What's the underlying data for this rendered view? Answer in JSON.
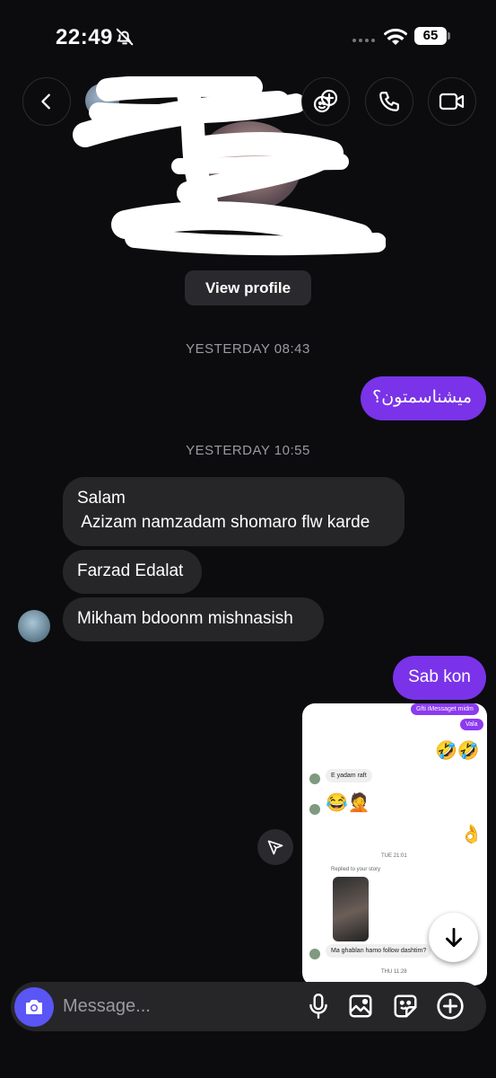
{
  "status_bar": {
    "time": "22:49",
    "battery": "65"
  },
  "profile": {
    "view_profile_label": "View profile"
  },
  "timestamps": [
    "YESTERDAY 08:43",
    "YESTERDAY 10:55"
  ],
  "messages": [
    {
      "direction": "outgoing",
      "text": "میشناسمتون؟"
    },
    {
      "direction": "incoming",
      "text": "Salam\n Azizam namzadam shomaro flw karde"
    },
    {
      "direction": "incoming",
      "text": "Farzad Edalat"
    },
    {
      "direction": "incoming",
      "text": "Mikham bdoonm mishnasish"
    },
    {
      "direction": "outgoing",
      "text": "Sab kon"
    }
  ],
  "screenshot": {
    "texts": {
      "purple1": "Gfti iMessaget midm",
      "purple2": "Vala",
      "gray1": "E yadam raft",
      "time1": "TUE 21:01",
      "replied": "Replied to your story",
      "gray2": "Ma ghablan hamo follow dashtim?",
      "time2": "THU 11:28"
    },
    "emojis": {
      "e1": "🤣🤣",
      "e2": "😂🤦",
      "e3": "👌"
    }
  },
  "composer": {
    "placeholder": "Message..."
  },
  "colors": {
    "accent": "#7a33e8",
    "camera": "#5a55f5",
    "incoming_bubble": "#262629"
  }
}
